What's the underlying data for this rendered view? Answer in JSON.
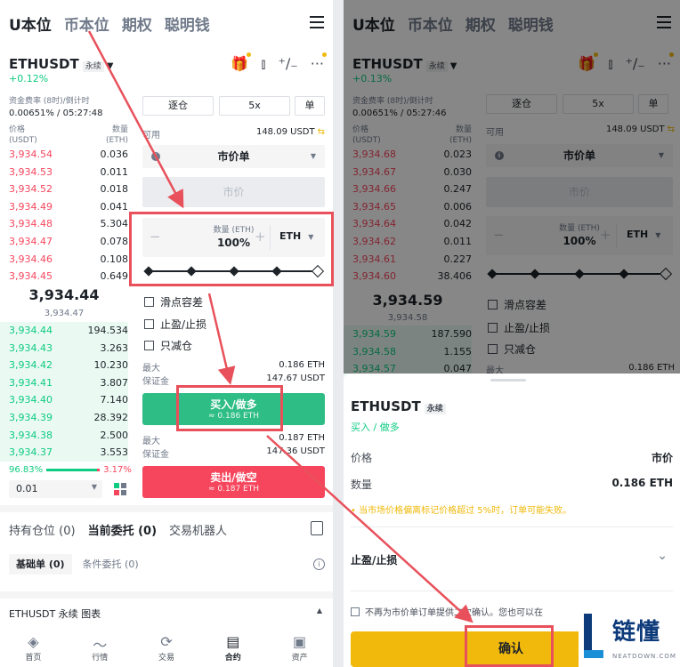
{
  "tabs": [
    "U本位",
    "币本位",
    "期权",
    "聪明钱"
  ],
  "symbol": "ETHUSDT",
  "perp_label": "永续",
  "left": {
    "change": "+0.12%",
    "funding_label": "资金费率 (8时)/倒计时",
    "funding_value": "0.00651% / 05:27:48",
    "ob_price_label": "价格",
    "ob_price_unit": "(USDT)",
    "ob_qty_label": "数量",
    "ob_qty_unit": "(ETH)",
    "asks": [
      {
        "p": "3,934.54",
        "q": "0.036"
      },
      {
        "p": "3,934.53",
        "q": "0.011"
      },
      {
        "p": "3,934.52",
        "q": "0.018"
      },
      {
        "p": "3,934.49",
        "q": "0.041"
      },
      {
        "p": "3,934.48",
        "q": "5.304"
      },
      {
        "p": "3,934.47",
        "q": "0.078"
      },
      {
        "p": "3,934.46",
        "q": "0.108"
      },
      {
        "p": "3,934.45",
        "q": "0.649"
      }
    ],
    "last_price": "3,934.44",
    "mark_price": "3,934.47",
    "bids": [
      {
        "p": "3,934.44",
        "q": "194.534"
      },
      {
        "p": "3,934.43",
        "q": "3.263"
      },
      {
        "p": "3,934.42",
        "q": "10.230"
      },
      {
        "p": "3,934.41",
        "q": "3.807"
      },
      {
        "p": "3,934.40",
        "q": "7.140"
      },
      {
        "p": "3,934.39",
        "q": "28.392"
      },
      {
        "p": "3,934.38",
        "q": "2.500"
      },
      {
        "p": "3,934.37",
        "q": "3.553"
      }
    ],
    "buy_ratio": "96.83%",
    "sell_ratio": "3.17%",
    "depth": "0.01",
    "margin_mode": "逐仓",
    "leverage": "5x",
    "mode_single": "单",
    "avail_label": "可用",
    "avail_value": "148.09 USDT",
    "order_type": "市价单",
    "market_placeholder": "市价",
    "qty_label": "数量 (ETH)",
    "qty_value": "100%",
    "qty_unit": "ETH",
    "slider_level": 1.0,
    "options": [
      "滑点容差",
      "止盈/止损",
      "只减仓"
    ],
    "buy_max_label": "最大",
    "buy_max_value": "0.186 ETH",
    "buy_margin_label": "保证金",
    "buy_margin_value": "147.67 USDT",
    "buy_btn": "买入/做多",
    "buy_btn_sub": "≈ 0.186 ETH",
    "sell_max_label": "最大",
    "sell_max_value": "0.187 ETH",
    "sell_margin_label": "保证金",
    "sell_margin_value": "147.36 USDT",
    "sell_btn": "卖出/做空",
    "sell_btn_sub": "≈ 0.187 ETH",
    "pos_tabs": [
      "持有仓位 (0)",
      "当前委托 (0)",
      "交易机器人"
    ],
    "sub_tabs": [
      "基础单 (0)",
      "条件委托 (0)"
    ],
    "chart_bar": "ETHUSDT 永续  图表",
    "nav": [
      "首页",
      "行情",
      "交易",
      "合约",
      "资产"
    ]
  },
  "right": {
    "change": "+0.13%",
    "funding_label": "资金费率 (8时)/倒计时",
    "funding_value": "0.00651% / 05:27:46",
    "ob_price_label": "价格",
    "ob_price_unit": "(USDT)",
    "ob_qty_label": "数量",
    "ob_qty_unit": "(ETH)",
    "asks": [
      {
        "p": "3,934.68",
        "q": "0.023"
      },
      {
        "p": "3,934.67",
        "q": "0.030"
      },
      {
        "p": "3,934.66",
        "q": "0.247"
      },
      {
        "p": "3,934.65",
        "q": "0.006"
      },
      {
        "p": "3,934.64",
        "q": "0.042"
      },
      {
        "p": "3,934.62",
        "q": "0.011"
      },
      {
        "p": "3,934.61",
        "q": "0.227"
      },
      {
        "p": "3,934.60",
        "q": "38.406"
      }
    ],
    "last_price": "3,934.59",
    "mark_price": "3,934.58",
    "bids": [
      {
        "p": "3,934.59",
        "q": "187.590"
      },
      {
        "p": "3,934.58",
        "q": "1.155"
      },
      {
        "p": "3,934.57",
        "q": "0.047"
      }
    ],
    "margin_mode": "逐仓",
    "leverage": "5x",
    "mode_single": "单",
    "avail_label": "可用",
    "avail_value": "148.09 USDT",
    "order_type": "市价单",
    "market_placeholder": "市价",
    "qty_label": "数量 (ETH)",
    "qty_value": "100%",
    "qty_unit": "ETH",
    "options": [
      "滑点容差",
      "止盈/止损",
      "只减仓"
    ],
    "max_label": "最大",
    "max_value": "0.186 ETH"
  },
  "sheet": {
    "title": "ETHUSDT",
    "perp": "永续",
    "side": "买入 / 做多",
    "price_label": "价格",
    "price_value": "市价",
    "qty_label": "数量",
    "qty_value": "0.186 ETH",
    "warning": "• 当市场价格偏离标记价格超过 5%时，订单可能失败。",
    "tpsl_label": "止盈/止损",
    "no_confirm": "不再为市价单订单提供二次确认。您也可以在",
    "confirm": "确认"
  },
  "watermark": {
    "brand": "链懂",
    "domain": "NEATDOWN.COM"
  },
  "colors": {
    "buy": "#2ebd85",
    "sell": "#f6465d",
    "accent": "#f0b90b",
    "highlight": "#e8515b"
  }
}
